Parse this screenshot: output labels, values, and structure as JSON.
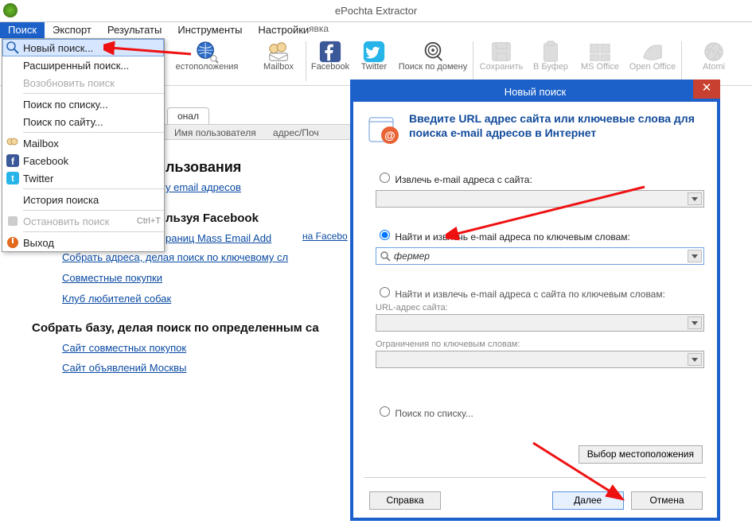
{
  "app": {
    "title": "ePochta Extractor",
    "menubar_fragment": "явка"
  },
  "menubar": [
    "Поиск",
    "Экспорт",
    "Результаты",
    "Инструменты",
    "Настройки"
  ],
  "dropdown": {
    "new_search": "Новый поиск...",
    "advanced": "Расширенный поиск...",
    "resume": "Возобновить поиск",
    "by_list": "Поиск по списку...",
    "by_site": "Поиск по сайту...",
    "mailbox": "Mailbox",
    "facebook": "Facebook",
    "twitter": "Twitter",
    "history": "История поиска",
    "stop": "Остановить поиск",
    "stop_hint": "Ctrl+T",
    "exit": "Выход"
  },
  "ribbon": {
    "loc": "естоположения",
    "mailbox": "Mailbox",
    "facebook": "Facebook",
    "twitter": "Twitter",
    "domain": "Поиск по домену",
    "save": "Сохранить",
    "buffer": "В Буфер",
    "msoffice": "MS Office",
    "openoffice": "Open Office",
    "atomic": "Atomi"
  },
  "background": {
    "tab": "онал",
    "subbar_col2": "Имя пользователя",
    "subbar_col3": "адрес/Поч",
    "h1a": "льзования",
    "link1": "у email адресов",
    "h2a": "льзуя Facebook",
    "link_fb_top": "на Facebo",
    "link2": "раниц Mass Email Add",
    "link3": "Собрать адреса, делая поиск по ключевому сл",
    "link4": "Совместные покупки",
    "link5": "Клуб любителей собак",
    "h2b": "Собрать базу, делая поиск по определенным са",
    "link6": "Сайт совместных покупок",
    "link7": "Сайт объявлений Москвы"
  },
  "dialog": {
    "title": "Новый поиск",
    "header": "Введите URL адрес сайта или ключевые слова для поиска e-mail адресов в Интернет",
    "opt1": "Извлечь e-mail адреса с сайта:",
    "opt2": "Найти и извлечь e-mail адреса по ключевым словам:",
    "keyword_value": "фермер",
    "opt3": "Найти и извлечь e-mail адреса с сайта по ключевым словам:",
    "sub_url": "URL-адрес сайта:",
    "sub_limit": "Ограничения по ключевым словам:",
    "opt4": "Поиск по списку...",
    "btn_loc": "Выбор местоположения",
    "btn_help": "Справка",
    "btn_next": "Далее",
    "btn_cancel": "Отмена"
  }
}
